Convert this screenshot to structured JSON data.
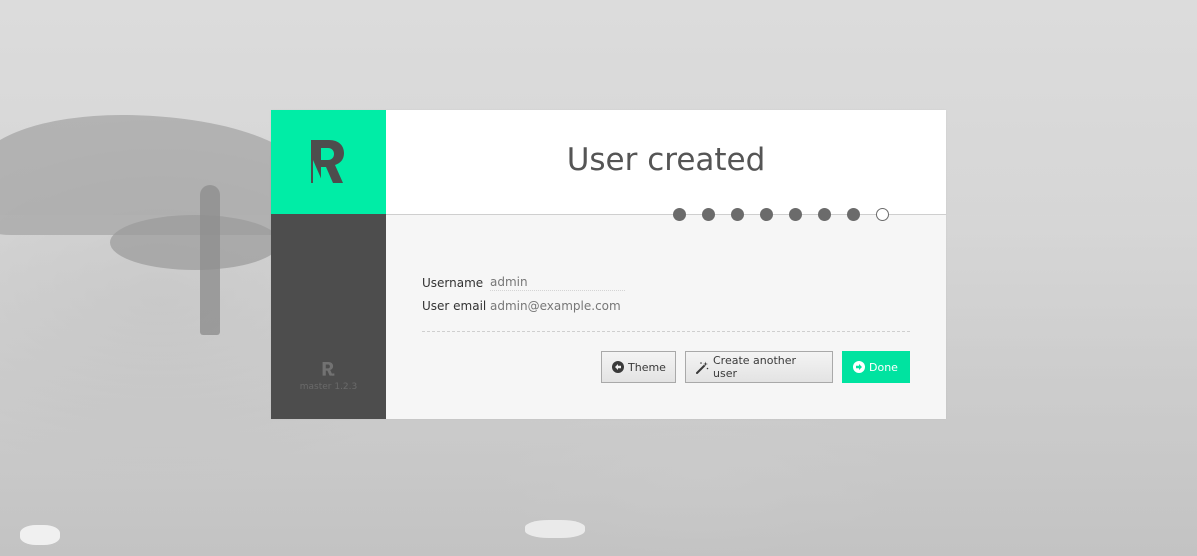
{
  "brand": {
    "accent_color": "#00eda6",
    "sidebar_color": "#4d4d4d",
    "version_text": "master 1.2.3"
  },
  "header": {
    "title": "User created"
  },
  "wizard": {
    "total_steps": 8,
    "current_step": 8
  },
  "user": {
    "username_label": "Username",
    "username_value": "admin",
    "email_label": "User email",
    "email_value": "admin@example.com"
  },
  "actions": {
    "theme_label": "Theme",
    "theme_icon": "arrow-left-circle-icon",
    "create_label": "Create another user",
    "create_icon": "magic-wand-icon",
    "done_label": "Done",
    "done_icon": "arrow-right-circle-icon"
  }
}
